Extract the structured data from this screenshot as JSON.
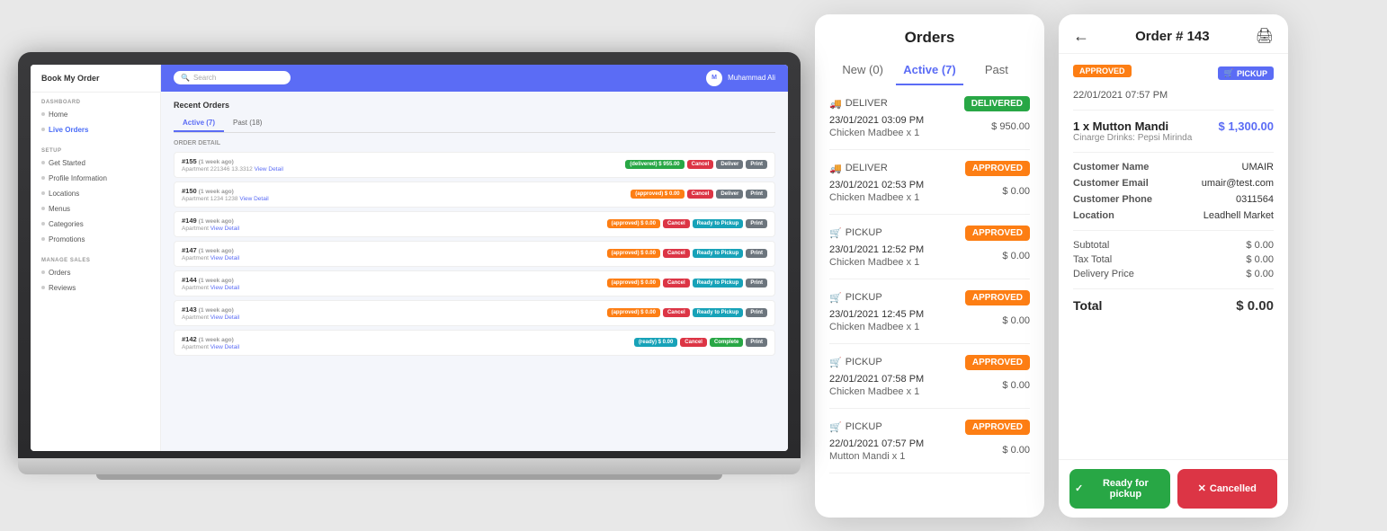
{
  "laptop": {
    "logo": "Book My Order",
    "search_placeholder": "Search",
    "user_name": "Muhammad Ali",
    "sidebar": {
      "dashboard_label": "DASHBOARD",
      "home_label": "Home",
      "live_orders_label": "Live Orders",
      "setup_label": "SETUP",
      "get_started_label": "Get Started",
      "profile_label": "Profile Information",
      "locations_label": "Locations",
      "menus_label": "Menus",
      "categories_label": "Categories",
      "promotions_label": "Promotions",
      "manage_label": "MANAGE SALES",
      "orders_label": "Orders",
      "reviews_label": "Reviews"
    },
    "recent_orders_title": "Recent Orders",
    "tab_active": "Active (7)",
    "tab_past": "Past (18)",
    "col_order_detail": "ORDER DETAIL",
    "orders": [
      {
        "id": "#155",
        "age": "(1 week ago)",
        "address": "Apartment 221346 13.3312",
        "link": "View Detail",
        "status": "(delivered) $ 955.00",
        "btn1": "Cancel",
        "btn2": "Deliver",
        "btn3": "Print",
        "badge": "delivered"
      },
      {
        "id": "#150",
        "age": "(1 week ago)",
        "address": "Apartment 1234 1238",
        "link": "View Detail",
        "status": "(approved) $ 0.00",
        "btn1": "Cancel",
        "btn2": "Deliver",
        "btn3": "Print",
        "badge": "approved"
      },
      {
        "id": "#149",
        "age": "(1 week ago)",
        "address": "Apartment",
        "link": "View Detail",
        "status": "(approved) $ 0.00",
        "btn1": "Cancel",
        "btn2": "Ready to Pickup",
        "btn3": "Print",
        "badge": "approved"
      },
      {
        "id": "#147",
        "age": "(1 week ago)",
        "address": "Apartment",
        "link": "View Detail",
        "status": "(approved) $ 0.00",
        "btn1": "Cancel",
        "btn2": "Ready to Pickup",
        "btn3": "Print",
        "badge": "approved"
      },
      {
        "id": "#144",
        "age": "(1 week ago)",
        "address": "Apartment",
        "link": "View Detail",
        "status": "(approved) $ 0.00",
        "btn1": "Cancel",
        "btn2": "Ready to Pickup",
        "btn3": "Print",
        "badge": "approved"
      },
      {
        "id": "#143",
        "age": "(1 week ago)",
        "address": "Apartment",
        "link": "View Detail",
        "status": "(approved) $ 0.00",
        "btn1": "Cancel",
        "btn2": "Ready to Pickup",
        "btn3": "Print",
        "badge": "approved"
      },
      {
        "id": "#142",
        "age": "(1 week ago)",
        "address": "Apartment",
        "link": "View Detail",
        "status": "(ready) $ 0.00",
        "btn1": "Cancel",
        "btn2": "Complete",
        "btn3": "Print",
        "badge": "ready"
      }
    ]
  },
  "orders_panel": {
    "title": "Orders",
    "tab_new": "New (0)",
    "tab_active": "Active (7)",
    "tab_past": "Past",
    "active_label": "Active",
    "orders": [
      {
        "type": "DELIVER",
        "badge": "DELIVERED",
        "badge_color": "green",
        "date": "23/01/2021 03:09 PM",
        "item": "Chicken Madbee x 1",
        "price": "$ 950.00"
      },
      {
        "type": "DELIVER",
        "badge": "APPROVED",
        "badge_color": "orange",
        "date": "23/01/2021 02:53 PM",
        "item": "Chicken Madbee x 1",
        "price": "$ 0.00"
      },
      {
        "type": "PICKUP",
        "badge": "APPROVED",
        "badge_color": "orange",
        "date": "23/01/2021 12:52 PM",
        "item": "Chicken Madbee x 1",
        "price": "$ 0.00"
      },
      {
        "type": "PICKUP",
        "badge": "APPROVED",
        "badge_color": "orange",
        "date": "23/01/2021 12:45 PM",
        "item": "Chicken Madbee x 1",
        "price": "$ 0.00"
      },
      {
        "type": "PICKUP",
        "badge": "APPROVED",
        "badge_color": "orange",
        "date": "22/01/2021 07:58 PM",
        "item": "Chicken Madbee x 1",
        "price": "$ 0.00"
      },
      {
        "type": "PICKUP",
        "badge": "APPROVED",
        "badge_color": "orange",
        "date": "22/01/2021 07:57 PM",
        "item": "Mutton Mandi x 1",
        "price": "$ 0.00"
      }
    ]
  },
  "detail_panel": {
    "back_icon": "←",
    "title": "Order # 143",
    "print_icon": "🖨",
    "approved_badge": "APPROVED",
    "pickup_badge": "PICKUP",
    "date": "22/01/2021 07:57 PM",
    "item_qty": "1 x Mutton Mandi",
    "item_price": "$ 1,300.00",
    "item_sub": "Cinarge Drinks: Pepsi Mirinda",
    "customer_name_label": "Customer Name",
    "customer_name_value": "UMAIR",
    "customer_email_label": "Customer Email",
    "customer_email_value": "umair@test.com",
    "customer_phone_label": "Customer Phone",
    "customer_phone_value": "0311564",
    "location_label": "Location",
    "location_value": "Leadhell Market",
    "subtotal_label": "Subtotal",
    "subtotal_value": "$ 0.00",
    "tax_label": "Tax Total",
    "tax_value": "$ 0.00",
    "delivery_label": "Delivery Price",
    "delivery_value": "$ 0.00",
    "total_label": "Total",
    "total_value": "$ 0.00",
    "btn_ready": "Ready for pickup",
    "btn_cancelled": "Cancelled"
  }
}
